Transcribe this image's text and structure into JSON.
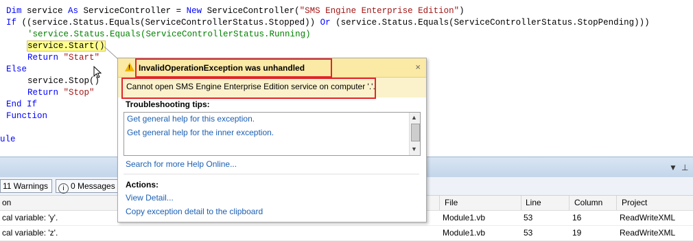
{
  "editor": {
    "lines": {
      "l1": {
        "kw1": "Dim",
        "t1": " service ",
        "kw2": "As",
        "t2": " ServiceController = ",
        "kw3": "New",
        "t3": " ServiceController(",
        "str": "\"SMS Engine Enterprise Edition\"",
        "t4": ")"
      },
      "l2": {
        "kw1": "If",
        "t1": " ((service.Status.Equals(ServiceControllerStatus.Stopped)) ",
        "kw2": "Or",
        "t2": " (service.Status.Equals(ServiceControllerStatus.StopPending)))"
      },
      "l3": {
        "cmt": "'service.Status.Equals(ServiceControllerStatus.Running)"
      },
      "l4": {
        "hl": "service.Start()"
      },
      "l5": {
        "kw": "Return",
        "str": " \"Start\""
      },
      "l6": {
        "kw": "Else"
      },
      "l7": {
        "t": "service.Stop()"
      },
      "l8": {
        "kw": "Return",
        "str": " \"Stop\""
      },
      "l9": {
        "kw": "End If"
      },
      "l10": {
        "kw": "Function"
      },
      "l11": {
        "kw": "ule"
      }
    }
  },
  "error_list": {
    "pin_label": "▼",
    "pin2_label": "⊥",
    "warnings_label": "11 Warnings",
    "messages_label": "0 Messages",
    "columns": {
      "description": "on",
      "file": "File",
      "line": "Line",
      "column": "Column",
      "project": "Project"
    },
    "rows": [
      {
        "description": "cal variable: 'y'.",
        "file": "Module1.vb",
        "line": "53",
        "column": "16",
        "project": "ReadWriteXML"
      },
      {
        "description": "cal variable: 'z'.",
        "file": "Module1.vb",
        "line": "53",
        "column": "19",
        "project": "ReadWriteXML"
      }
    ]
  },
  "exception_popup": {
    "title": "InvalidOperationException was unhandled",
    "close": "×",
    "message": "Cannot open SMS Engine Enterprise Edition service on computer '.'.",
    "tips_heading": "Troubleshooting tips:",
    "tips": [
      "Get general help for this exception.",
      "Get general help for the inner exception."
    ],
    "search_link": "Search for more Help Online...",
    "actions_heading": "Actions:",
    "actions": [
      "View Detail...",
      "Copy exception detail to the clipboard"
    ]
  },
  "colors": {
    "keyword": "#0000ff",
    "string": "#a31515",
    "comment": "#008000",
    "link": "#1a5fb4",
    "annotation": "#e0252b"
  }
}
